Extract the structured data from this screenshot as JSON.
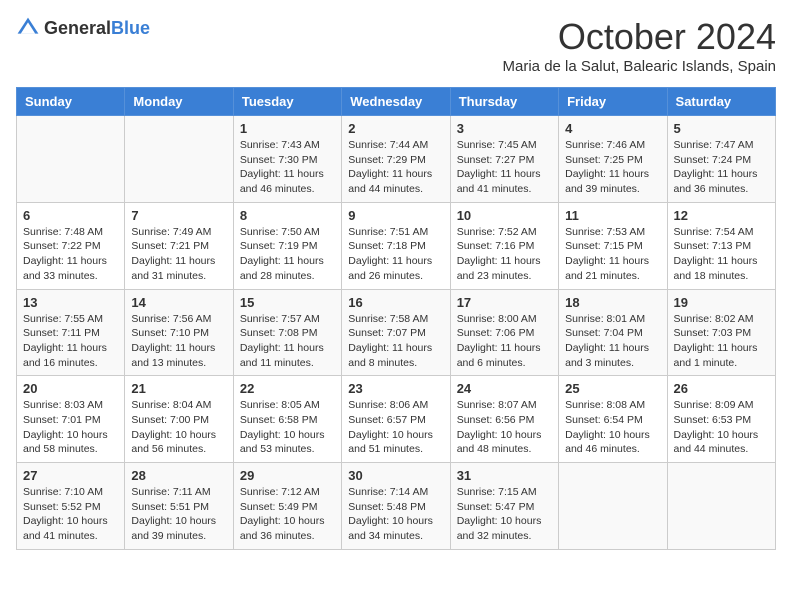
{
  "header": {
    "logo_general": "General",
    "logo_blue": "Blue",
    "month_title": "October 2024",
    "location": "Maria de la Salut, Balearic Islands, Spain"
  },
  "days_of_week": [
    "Sunday",
    "Monday",
    "Tuesday",
    "Wednesday",
    "Thursday",
    "Friday",
    "Saturday"
  ],
  "weeks": [
    [
      {
        "day": "",
        "info": ""
      },
      {
        "day": "",
        "info": ""
      },
      {
        "day": "1",
        "info": "Sunrise: 7:43 AM\nSunset: 7:30 PM\nDaylight: 11 hours and 46 minutes."
      },
      {
        "day": "2",
        "info": "Sunrise: 7:44 AM\nSunset: 7:29 PM\nDaylight: 11 hours and 44 minutes."
      },
      {
        "day": "3",
        "info": "Sunrise: 7:45 AM\nSunset: 7:27 PM\nDaylight: 11 hours and 41 minutes."
      },
      {
        "day": "4",
        "info": "Sunrise: 7:46 AM\nSunset: 7:25 PM\nDaylight: 11 hours and 39 minutes."
      },
      {
        "day": "5",
        "info": "Sunrise: 7:47 AM\nSunset: 7:24 PM\nDaylight: 11 hours and 36 minutes."
      }
    ],
    [
      {
        "day": "6",
        "info": "Sunrise: 7:48 AM\nSunset: 7:22 PM\nDaylight: 11 hours and 33 minutes."
      },
      {
        "day": "7",
        "info": "Sunrise: 7:49 AM\nSunset: 7:21 PM\nDaylight: 11 hours and 31 minutes."
      },
      {
        "day": "8",
        "info": "Sunrise: 7:50 AM\nSunset: 7:19 PM\nDaylight: 11 hours and 28 minutes."
      },
      {
        "day": "9",
        "info": "Sunrise: 7:51 AM\nSunset: 7:18 PM\nDaylight: 11 hours and 26 minutes."
      },
      {
        "day": "10",
        "info": "Sunrise: 7:52 AM\nSunset: 7:16 PM\nDaylight: 11 hours and 23 minutes."
      },
      {
        "day": "11",
        "info": "Sunrise: 7:53 AM\nSunset: 7:15 PM\nDaylight: 11 hours and 21 minutes."
      },
      {
        "day": "12",
        "info": "Sunrise: 7:54 AM\nSunset: 7:13 PM\nDaylight: 11 hours and 18 minutes."
      }
    ],
    [
      {
        "day": "13",
        "info": "Sunrise: 7:55 AM\nSunset: 7:11 PM\nDaylight: 11 hours and 16 minutes."
      },
      {
        "day": "14",
        "info": "Sunrise: 7:56 AM\nSunset: 7:10 PM\nDaylight: 11 hours and 13 minutes."
      },
      {
        "day": "15",
        "info": "Sunrise: 7:57 AM\nSunset: 7:08 PM\nDaylight: 11 hours and 11 minutes."
      },
      {
        "day": "16",
        "info": "Sunrise: 7:58 AM\nSunset: 7:07 PM\nDaylight: 11 hours and 8 minutes."
      },
      {
        "day": "17",
        "info": "Sunrise: 8:00 AM\nSunset: 7:06 PM\nDaylight: 11 hours and 6 minutes."
      },
      {
        "day": "18",
        "info": "Sunrise: 8:01 AM\nSunset: 7:04 PM\nDaylight: 11 hours and 3 minutes."
      },
      {
        "day": "19",
        "info": "Sunrise: 8:02 AM\nSunset: 7:03 PM\nDaylight: 11 hours and 1 minute."
      }
    ],
    [
      {
        "day": "20",
        "info": "Sunrise: 8:03 AM\nSunset: 7:01 PM\nDaylight: 10 hours and 58 minutes."
      },
      {
        "day": "21",
        "info": "Sunrise: 8:04 AM\nSunset: 7:00 PM\nDaylight: 10 hours and 56 minutes."
      },
      {
        "day": "22",
        "info": "Sunrise: 8:05 AM\nSunset: 6:58 PM\nDaylight: 10 hours and 53 minutes."
      },
      {
        "day": "23",
        "info": "Sunrise: 8:06 AM\nSunset: 6:57 PM\nDaylight: 10 hours and 51 minutes."
      },
      {
        "day": "24",
        "info": "Sunrise: 8:07 AM\nSunset: 6:56 PM\nDaylight: 10 hours and 48 minutes."
      },
      {
        "day": "25",
        "info": "Sunrise: 8:08 AM\nSunset: 6:54 PM\nDaylight: 10 hours and 46 minutes."
      },
      {
        "day": "26",
        "info": "Sunrise: 8:09 AM\nSunset: 6:53 PM\nDaylight: 10 hours and 44 minutes."
      }
    ],
    [
      {
        "day": "27",
        "info": "Sunrise: 7:10 AM\nSunset: 5:52 PM\nDaylight: 10 hours and 41 minutes."
      },
      {
        "day": "28",
        "info": "Sunrise: 7:11 AM\nSunset: 5:51 PM\nDaylight: 10 hours and 39 minutes."
      },
      {
        "day": "29",
        "info": "Sunrise: 7:12 AM\nSunset: 5:49 PM\nDaylight: 10 hours and 36 minutes."
      },
      {
        "day": "30",
        "info": "Sunrise: 7:14 AM\nSunset: 5:48 PM\nDaylight: 10 hours and 34 minutes."
      },
      {
        "day": "31",
        "info": "Sunrise: 7:15 AM\nSunset: 5:47 PM\nDaylight: 10 hours and 32 minutes."
      },
      {
        "day": "",
        "info": ""
      },
      {
        "day": "",
        "info": ""
      }
    ]
  ]
}
